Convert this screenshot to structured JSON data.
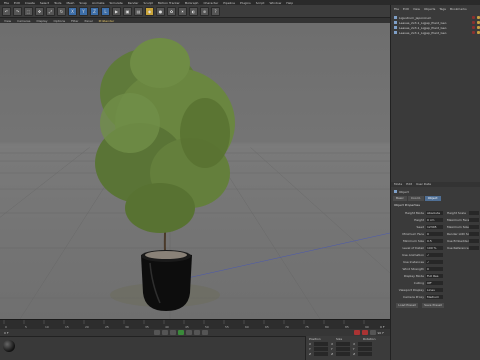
{
  "menubar": {
    "items": [
      "File",
      "Edit",
      "Create",
      "Select",
      "Tools",
      "Mesh",
      "Snap",
      "Animate",
      "Simulate",
      "Render",
      "Sculpt",
      "Motion Tracker",
      "MoGraph",
      "Character",
      "Pipeline",
      "Plugins",
      "Script",
      "Window",
      "Help"
    ]
  },
  "toolbar": {
    "buttons": [
      "↶",
      "↷",
      "⬚",
      "✥",
      "⤢",
      "↻",
      "X",
      "Y",
      "Z",
      "L",
      "▶",
      "▣",
      "▤",
      "◆",
      "●",
      "✿",
      "☀",
      "◐",
      "⊕",
      "?"
    ]
  },
  "view_menu": {
    "items": [
      "View",
      "Cameras",
      "Display",
      "Options",
      "Filter",
      "Panel",
      "ProRender"
    ],
    "active_index": 6
  },
  "object_manager": {
    "menu": [
      "File",
      "Edit",
      "View",
      "Objects",
      "Tags",
      "Bookmarks"
    ],
    "rows": [
      "Ligustrum_Japonicum",
      "Leaves_2x3.1_Ligjap_Plant_Geo",
      "Leaves_2x3.1_Ligjap_Plant_Geo",
      "Leaves_2x3.1_Ligjap_Plant_Geo"
    ]
  },
  "attributes": {
    "menu": [
      "Mode",
      "Edit",
      "User Data"
    ],
    "object_label": "Object",
    "tabs": [
      "Basic",
      "Coord.",
      "Object"
    ],
    "active_tab": 2,
    "section": "Object Properties",
    "rows": [
      {
        "label": "Height Mode",
        "value": "Absolute"
      },
      {
        "label": "Height",
        "value": "0 cm"
      },
      {
        "label": "Seed",
        "value": "12345"
      },
      {
        "label": "Minimum Face",
        "value": "0"
      },
      {
        "label": "Minimum Size",
        "value": "0.5"
      },
      {
        "label": "Level of Detail",
        "value": "100 %"
      },
      {
        "label": "Use Animation",
        "value": "✓"
      },
      {
        "label": "Use Instances",
        "value": "✓"
      },
      {
        "label": "Wind Strength",
        "value": "0"
      },
      {
        "label": "Display Mode",
        "value": "Full Res"
      },
      {
        "label": "Culling",
        "value": "Off"
      },
      {
        "label": "Viewport Display",
        "value": "Lines"
      },
      {
        "label": "Camera Proxy",
        "value": "Medium"
      }
    ],
    "rows_right": [
      "Height Scale",
      "Maximum Face",
      "Maximum Size",
      "Render LOD Scale",
      "Use Embedded",
      "Use Reference"
    ],
    "buttons": [
      "Load Preset",
      "Save Preset"
    ]
  },
  "timeline": {
    "ticks": [
      "0",
      "5",
      "10",
      "15",
      "20",
      "25",
      "30",
      "35",
      "40",
      "45",
      "50",
      "55",
      "60",
      "65",
      "70",
      "75",
      "80",
      "85",
      "90"
    ],
    "end_label": "0 F"
  },
  "transport": {
    "frame_start": "0 F",
    "frame_end": "90 F"
  },
  "coords": {
    "headers": [
      "Position",
      "Size",
      "Rotation"
    ],
    "axes": [
      "X",
      "Y",
      "Z"
    ],
    "apply": "Apply"
  }
}
